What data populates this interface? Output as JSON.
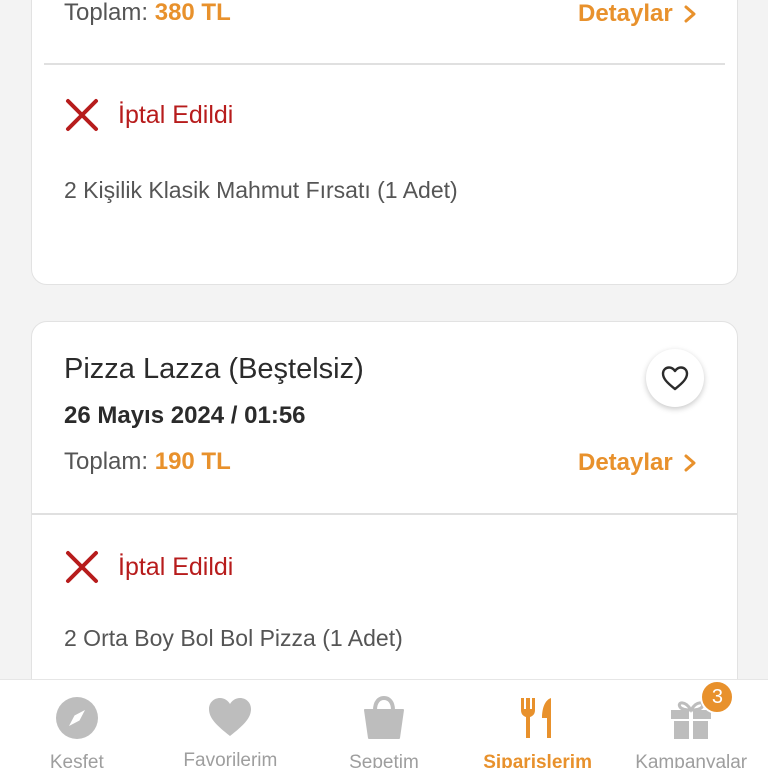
{
  "colors": {
    "accent": "#e8912c",
    "cancel_red": "#b71c1c",
    "muted": "#9e9e9e"
  },
  "orders": [
    {
      "total_label": "Toplam:",
      "total_amount": "380 TL",
      "details_label": "Detaylar",
      "status": "İptal Edildi",
      "items": [
        "2 Kişilik Klasik Mahmut Fırsatı (1 Adet)"
      ]
    },
    {
      "restaurant": "Pizza Lazza (Beştelsiz)",
      "date": "26 Mayıs 2024 / 01:56",
      "total_label": "Toplam:",
      "total_amount": "190 TL",
      "details_label": "Detaylar",
      "status": "İptal Edildi",
      "items": [
        "2 Orta Boy Bol Bol Pizza (1 Adet)"
      ],
      "favorite_icon": "heart-outline-icon"
    }
  ],
  "bottom_nav": [
    {
      "label": "Keşfet",
      "icon": "compass-icon",
      "active": false
    },
    {
      "label": "Favorilerim",
      "icon": "heart-icon",
      "active": false
    },
    {
      "label": "Sepetim",
      "icon": "shopping-bag-icon",
      "active": false
    },
    {
      "label": "Siparişlerim",
      "icon": "fork-knife-icon",
      "active": true
    },
    {
      "label": "Kampanyalar",
      "icon": "gift-icon",
      "active": false,
      "badge": "3"
    }
  ]
}
